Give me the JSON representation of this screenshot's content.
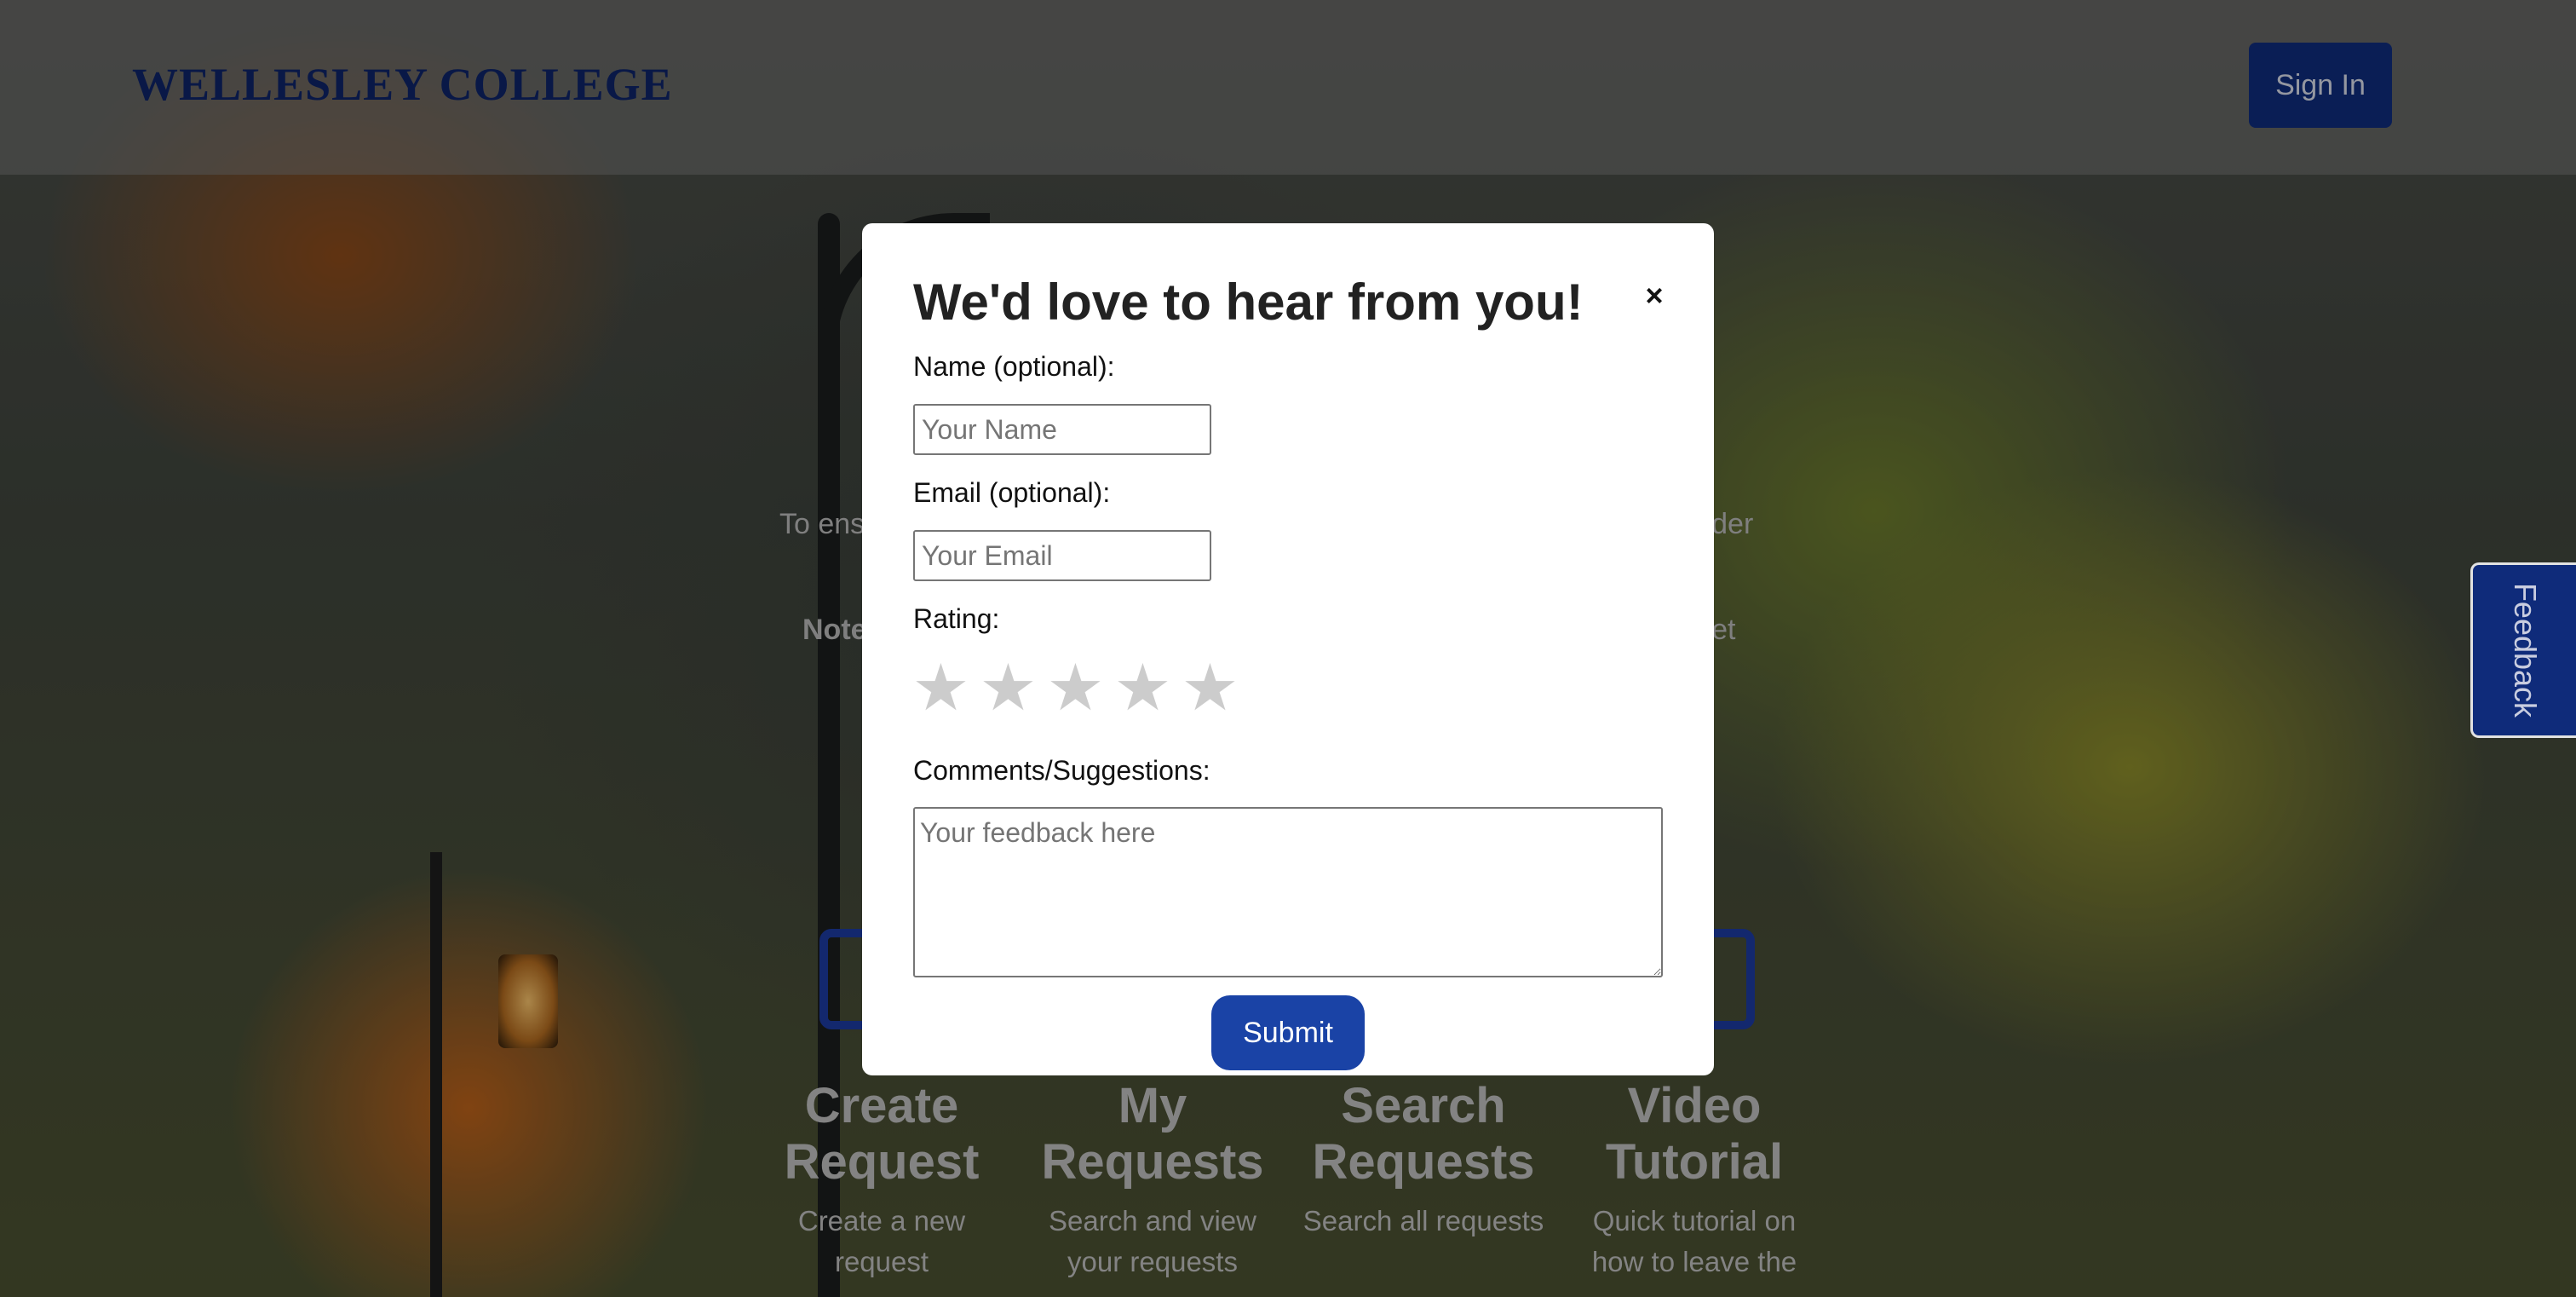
{
  "header": {
    "logo_text": "WELLESLEY COLLEGE",
    "signin_label": "Sign In"
  },
  "background": {
    "intro_left": "To ens",
    "intro_right": "t order",
    "note_left": "Note",
    "note_right": "ernet",
    "cards": [
      {
        "title": "Create Request",
        "desc": "Create a new request"
      },
      {
        "title": "My Requests",
        "desc": "Search and view your requests"
      },
      {
        "title": "Search Requests",
        "desc": "Search all requests"
      },
      {
        "title": "Video Tutorial",
        "desc": "Quick tutorial on how to leave the"
      }
    ]
  },
  "feedback_tab": {
    "label": "Feedback"
  },
  "modal": {
    "title": "We'd love to hear from you!",
    "close_glyph": "×",
    "name_label": "Name (optional):",
    "name_placeholder": "Your Name",
    "name_value": "",
    "email_label": "Email (optional):",
    "email_placeholder": "Your Email",
    "email_value": "",
    "rating_label": "Rating:",
    "rating_max": 5,
    "rating_value": 0,
    "star_glyph": "★",
    "comments_label": "Comments/Suggestions:",
    "comments_placeholder": "Your feedback here",
    "submit_label": "Submit"
  },
  "colors": {
    "brand_navy": "#0f2b7a",
    "submit_blue": "#1a43a6",
    "star_inactive": "#cccccc"
  }
}
